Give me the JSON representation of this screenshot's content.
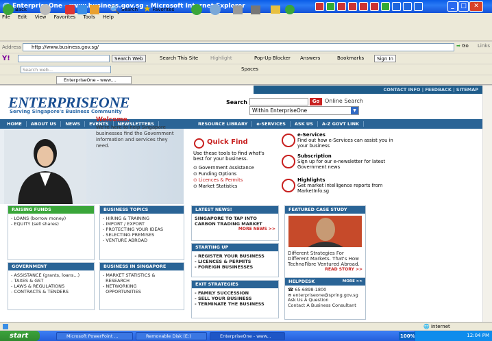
{
  "window": {
    "title": "EnterpriseOne - www.business.gov.sg - Microsoft Internet Explorer"
  },
  "menu": [
    "File",
    "Edit",
    "View",
    "Favorites",
    "Tools",
    "Help"
  ],
  "toolbar": {
    "back": "Back",
    "search": "Search",
    "favorites": "Favorites"
  },
  "address": {
    "label": "Address",
    "url": "http://www.business.gov.sg/",
    "go": "Go",
    "links": "Links"
  },
  "yahoo": {
    "search_web": "Search Web",
    "search_site": "Search This Site",
    "highlight": "Highlight",
    "popup": "Pop-Up Blocker",
    "answers": "Answers",
    "bookmarks": "Bookmarks",
    "signin": "Sign In"
  },
  "ask": {
    "placeholder": "Search web...",
    "spaces": "Spaces"
  },
  "tab": {
    "label": "EnterpriseOne - www...."
  },
  "site": {
    "topnav": "CONTACT INFO | FEEDBACK | SITEMAP",
    "logo": "ENTERPRISEONE",
    "tagline": "Serving Singapore's Business Community",
    "search_label": "Search",
    "go": "Go",
    "online_search": "Online Search",
    "within": "Within EnterpriseOne",
    "nav_left": [
      "HOME",
      "ABOUT US",
      "NEWS",
      "EVENTS",
      "NEWSLETTERS"
    ],
    "nav_right": [
      "RESOURCE LIBRARY",
      "e-SERVICES",
      "ASK US",
      "A-Z GOVT LINK"
    ],
    "welcome_title": "Welcome.",
    "welcome_text": "We're here to help Singapore businesses find the Government information and services they need.",
    "quickfind": "Quick Find",
    "quickfind_text": "Use these tools to find what's best for your business.",
    "quickfind_items": [
      "Government Assistance",
      "Funding Options",
      "Licences & Permits",
      "Market Statistics"
    ],
    "services": [
      {
        "title": "e-Services",
        "text": "Find out how e-Services can assist you in your business"
      },
      {
        "title": "Subscription",
        "text": "Sign up for our e-newsletter for latest Government news"
      },
      {
        "title": "Highlights",
        "text": "Get market intelligence reports from MarketInfo.sg"
      }
    ],
    "raising_funds": {
      "title": "RAISING FUNDS",
      "items": [
        "- LOANS (borrow money)",
        "- EQUITY (sell shares)"
      ]
    },
    "business_topics": {
      "title": "BUSINESS TOPICS",
      "items": [
        "- HIRING & TRAINING",
        "- IMPORT / EXPORT",
        "- PROTECTING YOUR IDEAS",
        "- SELECTING PREMISES",
        "- VENTURE ABROAD"
      ]
    },
    "latest_news": {
      "title": "LATEST NEWS!",
      "text": "SINGAPORE TO TAP INTO CARBON TRADING MARKET",
      "more": "MORE NEWS >>"
    },
    "featured": {
      "title": "FEATURED CASE STUDY",
      "text": "Different Strategies For Different Markets. That's How TechnoFibre Ventured Abroad.",
      "more": "READ STORY >>"
    },
    "starting_up": {
      "title": "STARTING UP",
      "items": [
        "- REGISTER YOUR BUSINESS",
        "- LICENCES & PERMITS",
        "- FOREIGN BUSINESSES"
      ]
    },
    "government": {
      "title": "GOVERNMENT",
      "items": [
        "- ASSISTANCE (grants, loans...)",
        "- TAXES & GST",
        "- LAWS & REGULATIONS",
        "- CONTRACTS & TENDERS"
      ]
    },
    "in_singapore": {
      "title": "BUSINESS IN SINGAPORE",
      "items": [
        "- MARKET STATISTICS &",
        "  RESEARCH",
        "- NETWORKING",
        "  OPPORTUNITIES"
      ]
    },
    "exit": {
      "title": "EXIT STRATEGIES",
      "items": [
        "- FAMILY SUCCESSION",
        "- SELL YOUR BUSINESS",
        "- TERMINATE THE BUSINESS"
      ]
    },
    "helpdesk": {
      "title": "HELPDESK",
      "more": "MORE >>",
      "items": [
        "65-6898-1800",
        "enterpriseone@spring.gov.sg",
        "Ask Us A Question",
        "Contact A Business Consultant"
      ]
    }
  },
  "status": {
    "zone": "Internet"
  },
  "taskbar": {
    "start": "start",
    "tasks": [
      "Microsoft PowerPoint ...",
      "Removable Disk (E:)",
      "EnterpriseOne - www..."
    ],
    "zoom": "100%",
    "time": "12:04 PM"
  },
  "colors": {
    "titlebar": "#0a5ce8",
    "nav": "#2a6496",
    "accent": "#c8201f",
    "green": "#3aa63a"
  }
}
